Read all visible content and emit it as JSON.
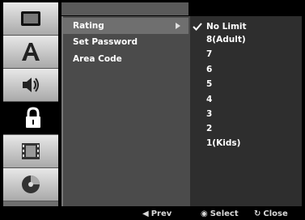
{
  "sidebar": {
    "tabs": [
      {
        "name": "display-tab",
        "icon": "tv-screen-icon"
      },
      {
        "name": "language-tab",
        "icon": "letter-a-icon"
      },
      {
        "name": "audio-tab",
        "icon": "speaker-icon"
      },
      {
        "name": "lock-tab",
        "icon": "padlock-icon",
        "active": true
      },
      {
        "name": "recording-tab",
        "icon": "film-icon"
      },
      {
        "name": "disc-tab",
        "icon": "disc-icon"
      }
    ]
  },
  "menu": {
    "items": [
      {
        "label": "Rating",
        "selected": true
      },
      {
        "label": "Set Password"
      },
      {
        "label": "Area Code"
      }
    ]
  },
  "options": {
    "items": [
      {
        "label": "No Limit",
        "checked": true
      },
      {
        "label": "8(Adult)"
      },
      {
        "label": "7"
      },
      {
        "label": "6"
      },
      {
        "label": "5"
      },
      {
        "label": "4"
      },
      {
        "label": "3"
      },
      {
        "label": "2"
      },
      {
        "label": "1(Kids)"
      }
    ]
  },
  "footer": {
    "prev_glyph": "◀",
    "prev": "Prev",
    "select_glyph": "◉",
    "select": "Select",
    "close_glyph": "↻",
    "close": "Close"
  },
  "colors": {
    "background": "#000000",
    "menu_bg": "#4b4b4b",
    "options_bg": "#2e2e2e",
    "tab_bg": "#c8c8c8"
  }
}
